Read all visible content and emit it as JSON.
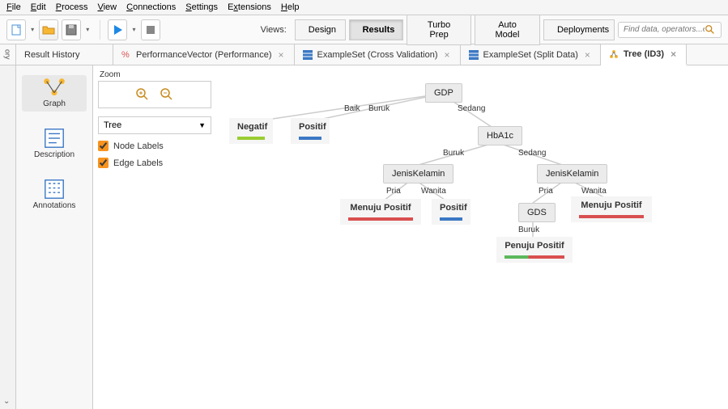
{
  "menu": [
    "File",
    "Edit",
    "Process",
    "View",
    "Connections",
    "Settings",
    "Extensions",
    "Help"
  ],
  "toolbar": {
    "views_label": "Views:",
    "views": [
      "Design",
      "Results",
      "Turbo Prep",
      "Auto Model",
      "Deployments"
    ],
    "active_view": "Results",
    "search_placeholder": "Find data, operators...etc"
  },
  "tabs": {
    "left_vertical": "ory",
    "items": [
      {
        "label": "Result History",
        "icon": "none",
        "closable": false
      },
      {
        "label": "PerformanceVector (Performance)",
        "icon": "percent",
        "closable": true
      },
      {
        "label": "ExampleSet (Cross Validation)",
        "icon": "table",
        "closable": true
      },
      {
        "label": "ExampleSet (Split Data)",
        "icon": "table",
        "closable": true
      },
      {
        "label": "Tree (ID3)",
        "icon": "tree",
        "closable": true,
        "active": true
      }
    ]
  },
  "sidebar": [
    {
      "label": "Graph",
      "icon": "graph",
      "active": true
    },
    {
      "label": "Description",
      "icon": "desc"
    },
    {
      "label": "Annotations",
      "icon": "annot"
    }
  ],
  "controls": {
    "zoom_label": "Zoom",
    "select_value": "Tree",
    "check_node": "Node Labels",
    "check_edge": "Edge Labels"
  },
  "tree": {
    "nodes": {
      "root": "GDP",
      "hba1c": "HbA1c",
      "jk1": "JenisKelamin",
      "jk2": "JenisKelamin",
      "gds": "GDS"
    },
    "leaves": {
      "neg": "Negatif",
      "pos1": "Positif",
      "mpos1": "Menuju Positif",
      "pos2": "Positif",
      "mpos2": "Menuju Positif",
      "ppos": "Penuju Positif"
    },
    "edges": {
      "baik": "Baik",
      "buruk1": "Buruk",
      "sedang1": "Sedang",
      "buruk2": "Buruk",
      "sedang2": "Sedang",
      "pria1": "Pria",
      "wanita1": "Wanita",
      "pria2": "Pria",
      "wanita2": "Wanita",
      "buruk3": "Buruk"
    }
  },
  "colors": {
    "green": "#9acd32",
    "blue": "#3b78c4",
    "red": "#d94f4f",
    "green2": "#5cb85c"
  }
}
